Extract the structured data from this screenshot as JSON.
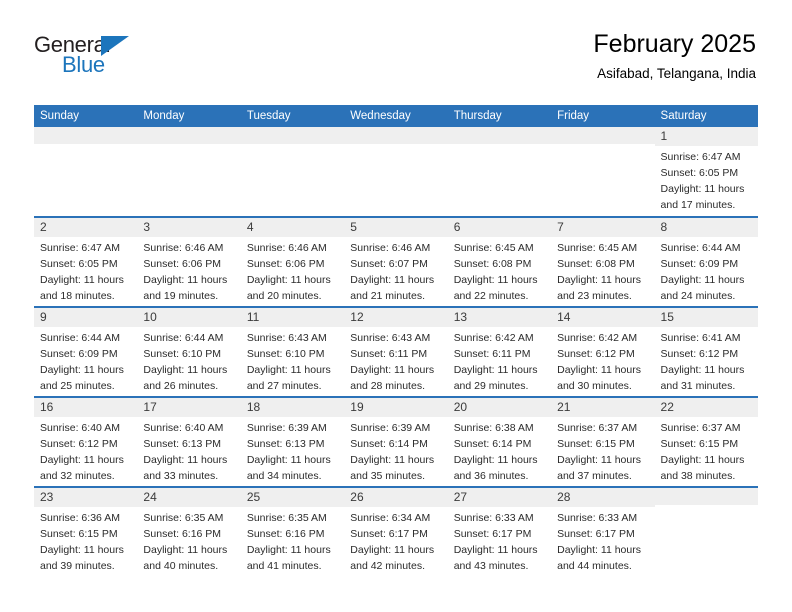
{
  "brand": {
    "name_top": "General",
    "name_bottom": "Blue",
    "accent_color": "#1c75bc"
  },
  "header": {
    "title": "February 2025",
    "subtitle": "Asifabad, Telangana, India"
  },
  "theme": {
    "header_blue": "#2b72b8",
    "daynum_gray": "#efefef",
    "text": "#2b2b2b"
  },
  "weekdays": [
    "Sunday",
    "Monday",
    "Tuesday",
    "Wednesday",
    "Thursday",
    "Friday",
    "Saturday"
  ],
  "labels": {
    "sunrise": "Sunrise:",
    "sunset": "Sunset:",
    "daylight": "Daylight:"
  },
  "weeks": [
    [
      {
        "day": "",
        "empty": true
      },
      {
        "day": "",
        "empty": true
      },
      {
        "day": "",
        "empty": true
      },
      {
        "day": "",
        "empty": true
      },
      {
        "day": "",
        "empty": true
      },
      {
        "day": "",
        "empty": true
      },
      {
        "day": "1",
        "sunrise": "Sunrise: 6:47 AM",
        "sunset": "Sunset: 6:05 PM",
        "daylight_1": "Daylight: 11 hours",
        "daylight_2": "and 17 minutes."
      }
    ],
    [
      {
        "day": "2",
        "sunrise": "Sunrise: 6:47 AM",
        "sunset": "Sunset: 6:05 PM",
        "daylight_1": "Daylight: 11 hours",
        "daylight_2": "and 18 minutes."
      },
      {
        "day": "3",
        "sunrise": "Sunrise: 6:46 AM",
        "sunset": "Sunset: 6:06 PM",
        "daylight_1": "Daylight: 11 hours",
        "daylight_2": "and 19 minutes."
      },
      {
        "day": "4",
        "sunrise": "Sunrise: 6:46 AM",
        "sunset": "Sunset: 6:06 PM",
        "daylight_1": "Daylight: 11 hours",
        "daylight_2": "and 20 minutes."
      },
      {
        "day": "5",
        "sunrise": "Sunrise: 6:46 AM",
        "sunset": "Sunset: 6:07 PM",
        "daylight_1": "Daylight: 11 hours",
        "daylight_2": "and 21 minutes."
      },
      {
        "day": "6",
        "sunrise": "Sunrise: 6:45 AM",
        "sunset": "Sunset: 6:08 PM",
        "daylight_1": "Daylight: 11 hours",
        "daylight_2": "and 22 minutes."
      },
      {
        "day": "7",
        "sunrise": "Sunrise: 6:45 AM",
        "sunset": "Sunset: 6:08 PM",
        "daylight_1": "Daylight: 11 hours",
        "daylight_2": "and 23 minutes."
      },
      {
        "day": "8",
        "sunrise": "Sunrise: 6:44 AM",
        "sunset": "Sunset: 6:09 PM",
        "daylight_1": "Daylight: 11 hours",
        "daylight_2": "and 24 minutes."
      }
    ],
    [
      {
        "day": "9",
        "sunrise": "Sunrise: 6:44 AM",
        "sunset": "Sunset: 6:09 PM",
        "daylight_1": "Daylight: 11 hours",
        "daylight_2": "and 25 minutes."
      },
      {
        "day": "10",
        "sunrise": "Sunrise: 6:44 AM",
        "sunset": "Sunset: 6:10 PM",
        "daylight_1": "Daylight: 11 hours",
        "daylight_2": "and 26 minutes."
      },
      {
        "day": "11",
        "sunrise": "Sunrise: 6:43 AM",
        "sunset": "Sunset: 6:10 PM",
        "daylight_1": "Daylight: 11 hours",
        "daylight_2": "and 27 minutes."
      },
      {
        "day": "12",
        "sunrise": "Sunrise: 6:43 AM",
        "sunset": "Sunset: 6:11 PM",
        "daylight_1": "Daylight: 11 hours",
        "daylight_2": "and 28 minutes."
      },
      {
        "day": "13",
        "sunrise": "Sunrise: 6:42 AM",
        "sunset": "Sunset: 6:11 PM",
        "daylight_1": "Daylight: 11 hours",
        "daylight_2": "and 29 minutes."
      },
      {
        "day": "14",
        "sunrise": "Sunrise: 6:42 AM",
        "sunset": "Sunset: 6:12 PM",
        "daylight_1": "Daylight: 11 hours",
        "daylight_2": "and 30 minutes."
      },
      {
        "day": "15",
        "sunrise": "Sunrise: 6:41 AM",
        "sunset": "Sunset: 6:12 PM",
        "daylight_1": "Daylight: 11 hours",
        "daylight_2": "and 31 minutes."
      }
    ],
    [
      {
        "day": "16",
        "sunrise": "Sunrise: 6:40 AM",
        "sunset": "Sunset: 6:12 PM",
        "daylight_1": "Daylight: 11 hours",
        "daylight_2": "and 32 minutes."
      },
      {
        "day": "17",
        "sunrise": "Sunrise: 6:40 AM",
        "sunset": "Sunset: 6:13 PM",
        "daylight_1": "Daylight: 11 hours",
        "daylight_2": "and 33 minutes."
      },
      {
        "day": "18",
        "sunrise": "Sunrise: 6:39 AM",
        "sunset": "Sunset: 6:13 PM",
        "daylight_1": "Daylight: 11 hours",
        "daylight_2": "and 34 minutes."
      },
      {
        "day": "19",
        "sunrise": "Sunrise: 6:39 AM",
        "sunset": "Sunset: 6:14 PM",
        "daylight_1": "Daylight: 11 hours",
        "daylight_2": "and 35 minutes."
      },
      {
        "day": "20",
        "sunrise": "Sunrise: 6:38 AM",
        "sunset": "Sunset: 6:14 PM",
        "daylight_1": "Daylight: 11 hours",
        "daylight_2": "and 36 minutes."
      },
      {
        "day": "21",
        "sunrise": "Sunrise: 6:37 AM",
        "sunset": "Sunset: 6:15 PM",
        "daylight_1": "Daylight: 11 hours",
        "daylight_2": "and 37 minutes."
      },
      {
        "day": "22",
        "sunrise": "Sunrise: 6:37 AM",
        "sunset": "Sunset: 6:15 PM",
        "daylight_1": "Daylight: 11 hours",
        "daylight_2": "and 38 minutes."
      }
    ],
    [
      {
        "day": "23",
        "sunrise": "Sunrise: 6:36 AM",
        "sunset": "Sunset: 6:15 PM",
        "daylight_1": "Daylight: 11 hours",
        "daylight_2": "and 39 minutes."
      },
      {
        "day": "24",
        "sunrise": "Sunrise: 6:35 AM",
        "sunset": "Sunset: 6:16 PM",
        "daylight_1": "Daylight: 11 hours",
        "daylight_2": "and 40 minutes."
      },
      {
        "day": "25",
        "sunrise": "Sunrise: 6:35 AM",
        "sunset": "Sunset: 6:16 PM",
        "daylight_1": "Daylight: 11 hours",
        "daylight_2": "and 41 minutes."
      },
      {
        "day": "26",
        "sunrise": "Sunrise: 6:34 AM",
        "sunset": "Sunset: 6:17 PM",
        "daylight_1": "Daylight: 11 hours",
        "daylight_2": "and 42 minutes."
      },
      {
        "day": "27",
        "sunrise": "Sunrise: 6:33 AM",
        "sunset": "Sunset: 6:17 PM",
        "daylight_1": "Daylight: 11 hours",
        "daylight_2": "and 43 minutes."
      },
      {
        "day": "28",
        "sunrise": "Sunrise: 6:33 AM",
        "sunset": "Sunset: 6:17 PM",
        "daylight_1": "Daylight: 11 hours",
        "daylight_2": "and 44 minutes."
      },
      {
        "day": "",
        "empty": true
      }
    ]
  ]
}
